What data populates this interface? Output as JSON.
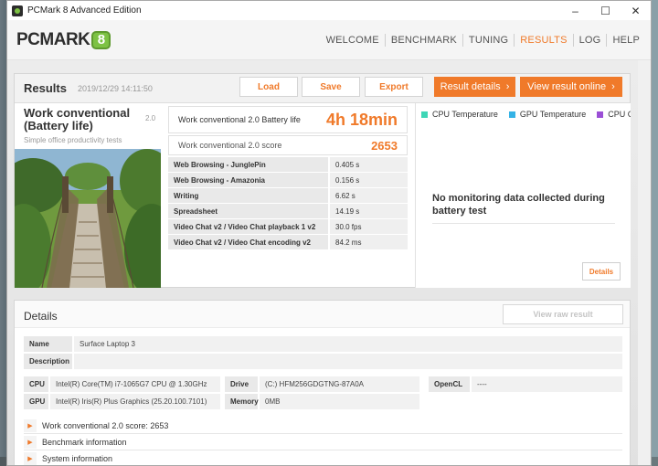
{
  "window": {
    "title": "PCMark 8 Advanced Edition",
    "controls": [
      "–",
      "☐",
      "✕"
    ]
  },
  "logo": {
    "text": "PCMARK",
    "badge": "8"
  },
  "nav": {
    "items": [
      "WELCOME",
      "BENCHMARK",
      "TUNING",
      "RESULTS",
      "LOG",
      "HELP"
    ],
    "active": "RESULTS"
  },
  "results": {
    "title": "Results",
    "date": "2019/12/29 14:11:50",
    "buttons": {
      "load": "Load",
      "save": "Save",
      "export": "Export",
      "result_details": "Result details",
      "view_online": "View result online"
    },
    "test": {
      "name": "Work conventional (Battery life)",
      "version": "2.0",
      "description": "Simple office productivity tests"
    },
    "battery": {
      "label": "Work conventional 2.0 Battery life",
      "value": "4h 18min"
    },
    "score": {
      "label": "Work conventional 2.0 score",
      "value": "2653"
    },
    "subtests": [
      {
        "name": "Web Browsing - JunglePin",
        "value": "0.405 s"
      },
      {
        "name": "Web Browsing - Amazonia",
        "value": "0.156 s"
      },
      {
        "name": "Writing",
        "value": "6.62 s"
      },
      {
        "name": "Spreadsheet",
        "value": "14.19 s"
      },
      {
        "name": "Video Chat v2 / Video Chat playback 1 v2",
        "value": "30.0 fps"
      },
      {
        "name": "Video Chat v2 / Video Chat encoding v2",
        "value": "84.2 ms"
      }
    ],
    "monitoring": {
      "legend": [
        {
          "label": "CPU Temperature",
          "color": "#3ed6b6"
        },
        {
          "label": "GPU Temperature",
          "color": "#35b3e6"
        },
        {
          "label": "CPU Clock",
          "color": "#9b4fd6"
        }
      ],
      "message": "No monitoring data collected during battery test",
      "details_button": "Details"
    }
  },
  "details": {
    "title": "Details",
    "raw_button": "View raw result",
    "name_label": "Name",
    "name_value": "Surface Laptop 3",
    "description_label": "Description",
    "description_value": "",
    "cpu_label": "CPU",
    "cpu_value": "Intel(R) Core(TM) i7-1065G7 CPU @ 1.30GHz",
    "gpu_label": "GPU",
    "gpu_value": "Intel(R) Iris(R) Plus Graphics (25.20.100.7101)",
    "drive_label": "Drive",
    "drive_value": "(C:) HFM256GDGTNG-87A0A",
    "memory_label": "Memory",
    "memory_value": "0MB",
    "opencl_label": "OpenCL",
    "opencl_value": "----",
    "expandables": [
      "Work conventional 2.0 score: 2653",
      "Benchmark information",
      "System information"
    ]
  },
  "colors": {
    "accent": "#f07a2a",
    "brand_green": "#7dc243"
  }
}
